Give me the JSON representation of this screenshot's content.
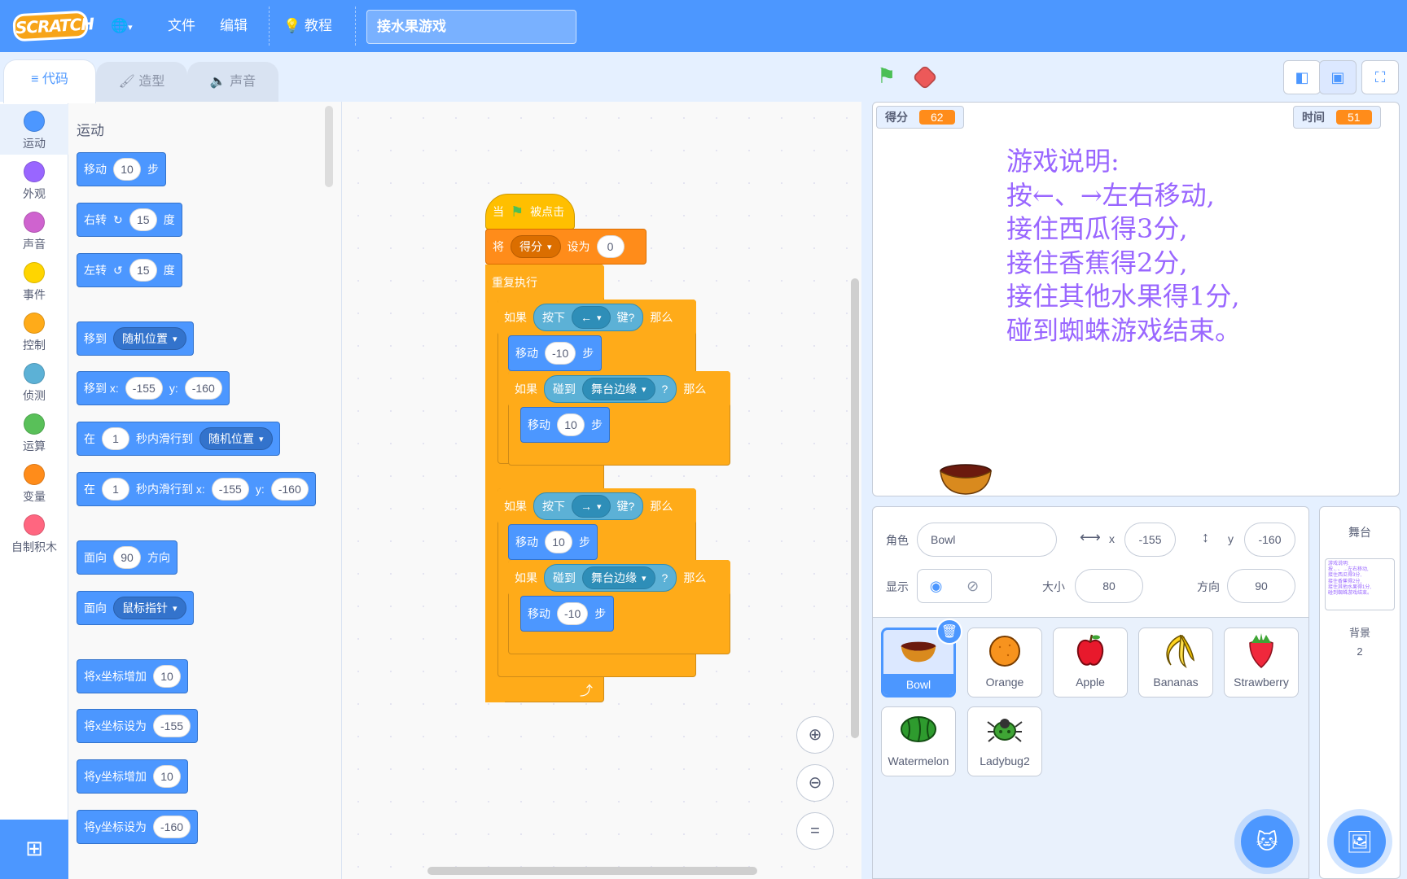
{
  "menu": {
    "logo": "SCRATCH",
    "file": "文件",
    "edit": "编辑",
    "tutorials": "教程",
    "project_title": "接水果游戏"
  },
  "tabs": [
    {
      "label": "代码"
    },
    {
      "label": "造型"
    },
    {
      "label": "声音"
    }
  ],
  "categories": [
    {
      "label": "运动",
      "color": "#4c97ff"
    },
    {
      "label": "外观",
      "color": "#9966ff"
    },
    {
      "label": "声音",
      "color": "#cf63cf"
    },
    {
      "label": "事件",
      "color": "#ffd500"
    },
    {
      "label": "控制",
      "color": "#ffab19"
    },
    {
      "label": "侦测",
      "color": "#5cb1d6"
    },
    {
      "label": "运算",
      "color": "#59c059"
    },
    {
      "label": "变量",
      "color": "#ff8c1a"
    },
    {
      "label": "自制积木",
      "color": "#ff6680"
    }
  ],
  "palette": {
    "title": "运动",
    "move": {
      "a": "移动",
      "v": "10",
      "b": "步"
    },
    "turn_right": {
      "a": "右转",
      "v": "15",
      "b": "度"
    },
    "turn_left": {
      "a": "左转",
      "v": "15",
      "b": "度"
    },
    "goto": {
      "a": "移到",
      "d": "随机位置"
    },
    "goto_xy": {
      "a": "移到 x:",
      "x": "-155",
      "b": "y:",
      "y": "-160"
    },
    "glide": {
      "a": "在",
      "v": "1",
      "b": "秒内滑行到",
      "d": "随机位置"
    },
    "glide_xy": {
      "a": "在",
      "v": "1",
      "b": "秒内滑行到 x:",
      "x": "-155",
      "c": "y:",
      "y": "-160"
    },
    "point_dir": {
      "a": "面向",
      "v": "90",
      "b": "方向"
    },
    "point_towards": {
      "a": "面向",
      "d": "鼠标指针"
    },
    "change_x": {
      "a": "将x坐标增加",
      "v": "10"
    },
    "set_x": {
      "a": "将x坐标设为",
      "v": "-155"
    },
    "change_y": {
      "a": "将y坐标增加",
      "v": "10"
    },
    "set_y": {
      "a": "将y坐标设为",
      "v": "-160"
    }
  },
  "script": {
    "hat": {
      "a": "当",
      "b": "被点击"
    },
    "set_var": {
      "a": "将",
      "var": "得分",
      "b": "设为",
      "v": "0"
    },
    "forever": "重复执行",
    "if": "如果",
    "then": "那么",
    "key_pressed": "按下",
    "key_suffix": "键?",
    "key_left": "←",
    "key_right": "→",
    "touching": "碰到",
    "edge": "舞台边缘",
    "q": "?",
    "move": "移动",
    "steps": "步",
    "v_neg10": "-10",
    "v_10": "10"
  },
  "stage": {
    "monitor_score": {
      "label": "得分",
      "value": "62"
    },
    "monitor_time": {
      "label": "时间",
      "value": "51"
    },
    "instructions": "游戏说明:\n按←、→左右移动,\n接住西瓜得3分,\n接住香蕉得2分,\n接住其他水果得1分,\n碰到蜘蛛游戏结束。"
  },
  "sprite_info": {
    "sprite_label": "角色",
    "sprite_name": "Bowl",
    "x_label": "x",
    "x": "-155",
    "y_label": "y",
    "y": "-160",
    "show_label": "显示",
    "size_label": "大小",
    "size": "80",
    "dir_label": "方向",
    "direction": "90"
  },
  "sprites": [
    {
      "name": "Bowl",
      "icon": "bowl-icon"
    },
    {
      "name": "Orange",
      "icon": "orange-icon"
    },
    {
      "name": "Apple",
      "icon": "apple-icon"
    },
    {
      "name": "Bananas",
      "icon": "bananas-icon"
    },
    {
      "name": "Strawberry",
      "icon": "strawberry-icon"
    },
    {
      "name": "Watermelon",
      "icon": "watermelon-icon"
    },
    {
      "name": "Ladybug2",
      "icon": "ladybug-icon"
    }
  ],
  "stage_pane": {
    "title": "舞台",
    "backdrop_label": "背景",
    "backdrop_count": "2"
  }
}
